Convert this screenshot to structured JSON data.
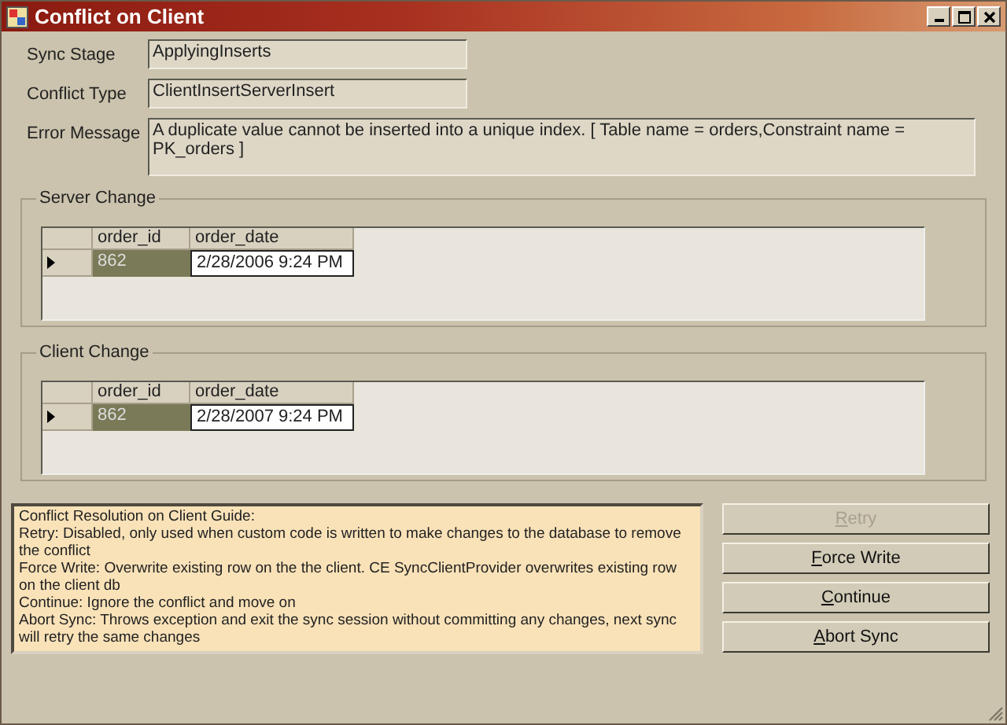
{
  "window": {
    "title": "Conflict on Client"
  },
  "fields": [
    {
      "label": "Sync Stage",
      "value": "ApplyingInserts",
      "kind": "single"
    },
    {
      "label": "Conflict Type",
      "value": "ClientInsertServerInsert",
      "kind": "single"
    },
    {
      "label": "Error Message",
      "value": "A duplicate value cannot be inserted into a unique index. [ Table name = orders,Constraint name = PK_orders ]",
      "kind": "multi"
    }
  ],
  "groups": [
    {
      "title": "Server Change",
      "columns": [
        "order_id",
        "order_date"
      ],
      "rows": [
        {
          "current": true,
          "cells": [
            {
              "text": "862",
              "selected": true
            },
            {
              "text": "2/28/2006 9:24 PM",
              "selected": false
            }
          ]
        }
      ]
    },
    {
      "title": "Client Change",
      "columns": [
        "order_id",
        "order_date"
      ],
      "rows": [
        {
          "current": true,
          "cells": [
            {
              "text": "862",
              "selected": true
            },
            {
              "text": "2/28/2007 9:24 PM",
              "selected": false
            }
          ]
        }
      ]
    }
  ],
  "guide": [
    "Conflict Resolution on Client Guide:",
    "Retry: Disabled, only used when custom code is written to make changes to the database to remove the conflict",
    "Force Write: Overwrite existing row on the the client. CE SyncClientProvider overwrites existing row on the client db",
    "Continue: Ignore the conflict and move on",
    " Abort Sync: Throws exception and exit the sync session without committing any changes, next sync will retry the same changes"
  ],
  "buttons": [
    {
      "label": "Retry",
      "disabled": true
    },
    {
      "label": "Force Write",
      "disabled": false
    },
    {
      "label": "Continue",
      "disabled": false
    },
    {
      "label": "Abort Sync",
      "disabled": false
    }
  ]
}
